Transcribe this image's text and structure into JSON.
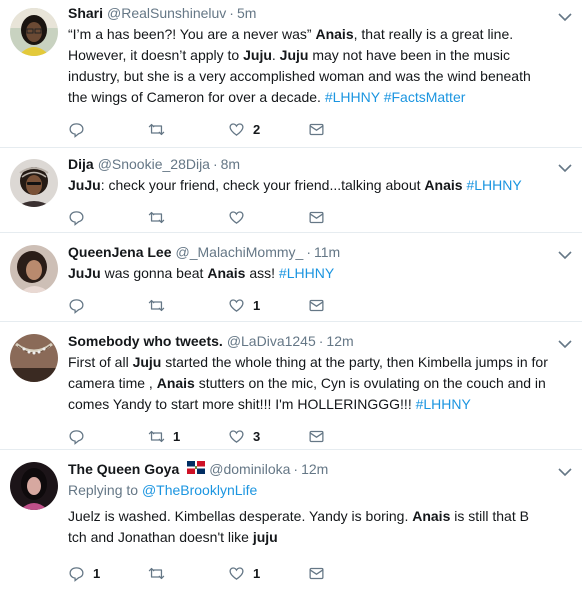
{
  "tweets": [
    {
      "name": "Shari",
      "handle": "@RealSunshineluv",
      "time": "5m",
      "avatar_icon": "avatar-woman-glasses",
      "body_parts": [
        {
          "t": "“I’m a has been?! You are a never was” ",
          "s": "text"
        },
        {
          "t": "Anais",
          "s": "bold"
        },
        {
          "t": ", that really is a great line. However, it doesn’t apply to ",
          "s": "text"
        },
        {
          "t": "Juju",
          "s": "bold"
        },
        {
          "t": ". ",
          "s": "text"
        },
        {
          "t": "Juju",
          "s": "bold"
        },
        {
          "t": " may not have been in the music industry, but she is a very accomplished woman and was the wind beneath the wings of Cameron for over a decade. ",
          "s": "text"
        },
        {
          "t": "#LHHNY",
          "s": "tag"
        },
        {
          "t": " ",
          "s": "text"
        },
        {
          "t": "#FactsMatter",
          "s": "tag"
        }
      ],
      "reply_count": "",
      "retweet_count": "",
      "like_count": "2"
    },
    {
      "name": "Dija",
      "handle": "@Snookie_28Dija",
      "time": "8m",
      "avatar_icon": "avatar-braids",
      "body_parts": [
        {
          "t": "JuJu",
          "s": "bold"
        },
        {
          "t": ": check your friend, check your friend...talking about ",
          "s": "text"
        },
        {
          "t": "Anais",
          "s": "bold"
        },
        {
          "t": " ",
          "s": "text"
        },
        {
          "t": "#LHHNY",
          "s": "tag"
        }
      ],
      "reply_count": "",
      "retweet_count": "",
      "like_count": ""
    },
    {
      "name": "QueenJena Lee",
      "handle": "@_MalachiMommy_",
      "time": "11m",
      "avatar_icon": "avatar-woman",
      "body_parts": [
        {
          "t": "JuJu",
          "s": "bold"
        },
        {
          "t": " was gonna beat ",
          "s": "text"
        },
        {
          "t": "Anais",
          "s": "bold"
        },
        {
          "t": " ass! ",
          "s": "text"
        },
        {
          "t": "#LHHNY",
          "s": "tag"
        }
      ],
      "reply_count": "",
      "retweet_count": "",
      "like_count": "1"
    },
    {
      "name": "Somebody who tweets.",
      "handle": "@LaDiva1245",
      "time": "12m",
      "avatar_icon": "avatar-necklace",
      "body_parts": [
        {
          "t": "First of all ",
          "s": "text"
        },
        {
          "t": "Juju",
          "s": "bold"
        },
        {
          "t": " started the whole thing at the party, then Kimbella jumps in for camera time , ",
          "s": "text"
        },
        {
          "t": "Anais",
          "s": "bold"
        },
        {
          "t": " stutters on the mic,  Cyn is ovulating on the couch and in comes Yandy to start more shit!!! I'm HOLLERINGGG!!!  ",
          "s": "text"
        },
        {
          "t": "#LHHNY",
          "s": "tag"
        }
      ],
      "reply_count": "",
      "retweet_count": "1",
      "like_count": "3"
    },
    {
      "name": "The Queen Goya",
      "handle": "@dominiloka",
      "time": "12m",
      "avatar_icon": "avatar-woman-pink",
      "replying_label": "Replying to ",
      "replying_handle": "@TheBrooklynLife",
      "body_parts": [
        {
          "t": "Juelz is washed. Kimbellas desperate. Yandy is boring. ",
          "s": "text"
        },
        {
          "t": "Anais",
          "s": "bold"
        },
        {
          "t": " is still that B tch and Jonathan doesn't like ",
          "s": "text"
        },
        {
          "t": "juju",
          "s": "bold"
        }
      ],
      "reply_count": "1",
      "retweet_count": "",
      "like_count": "1"
    }
  ],
  "colors": {
    "text": "#14171a",
    "muted": "#657786",
    "link": "#1b95e0",
    "divider": "#e6ecf0"
  }
}
